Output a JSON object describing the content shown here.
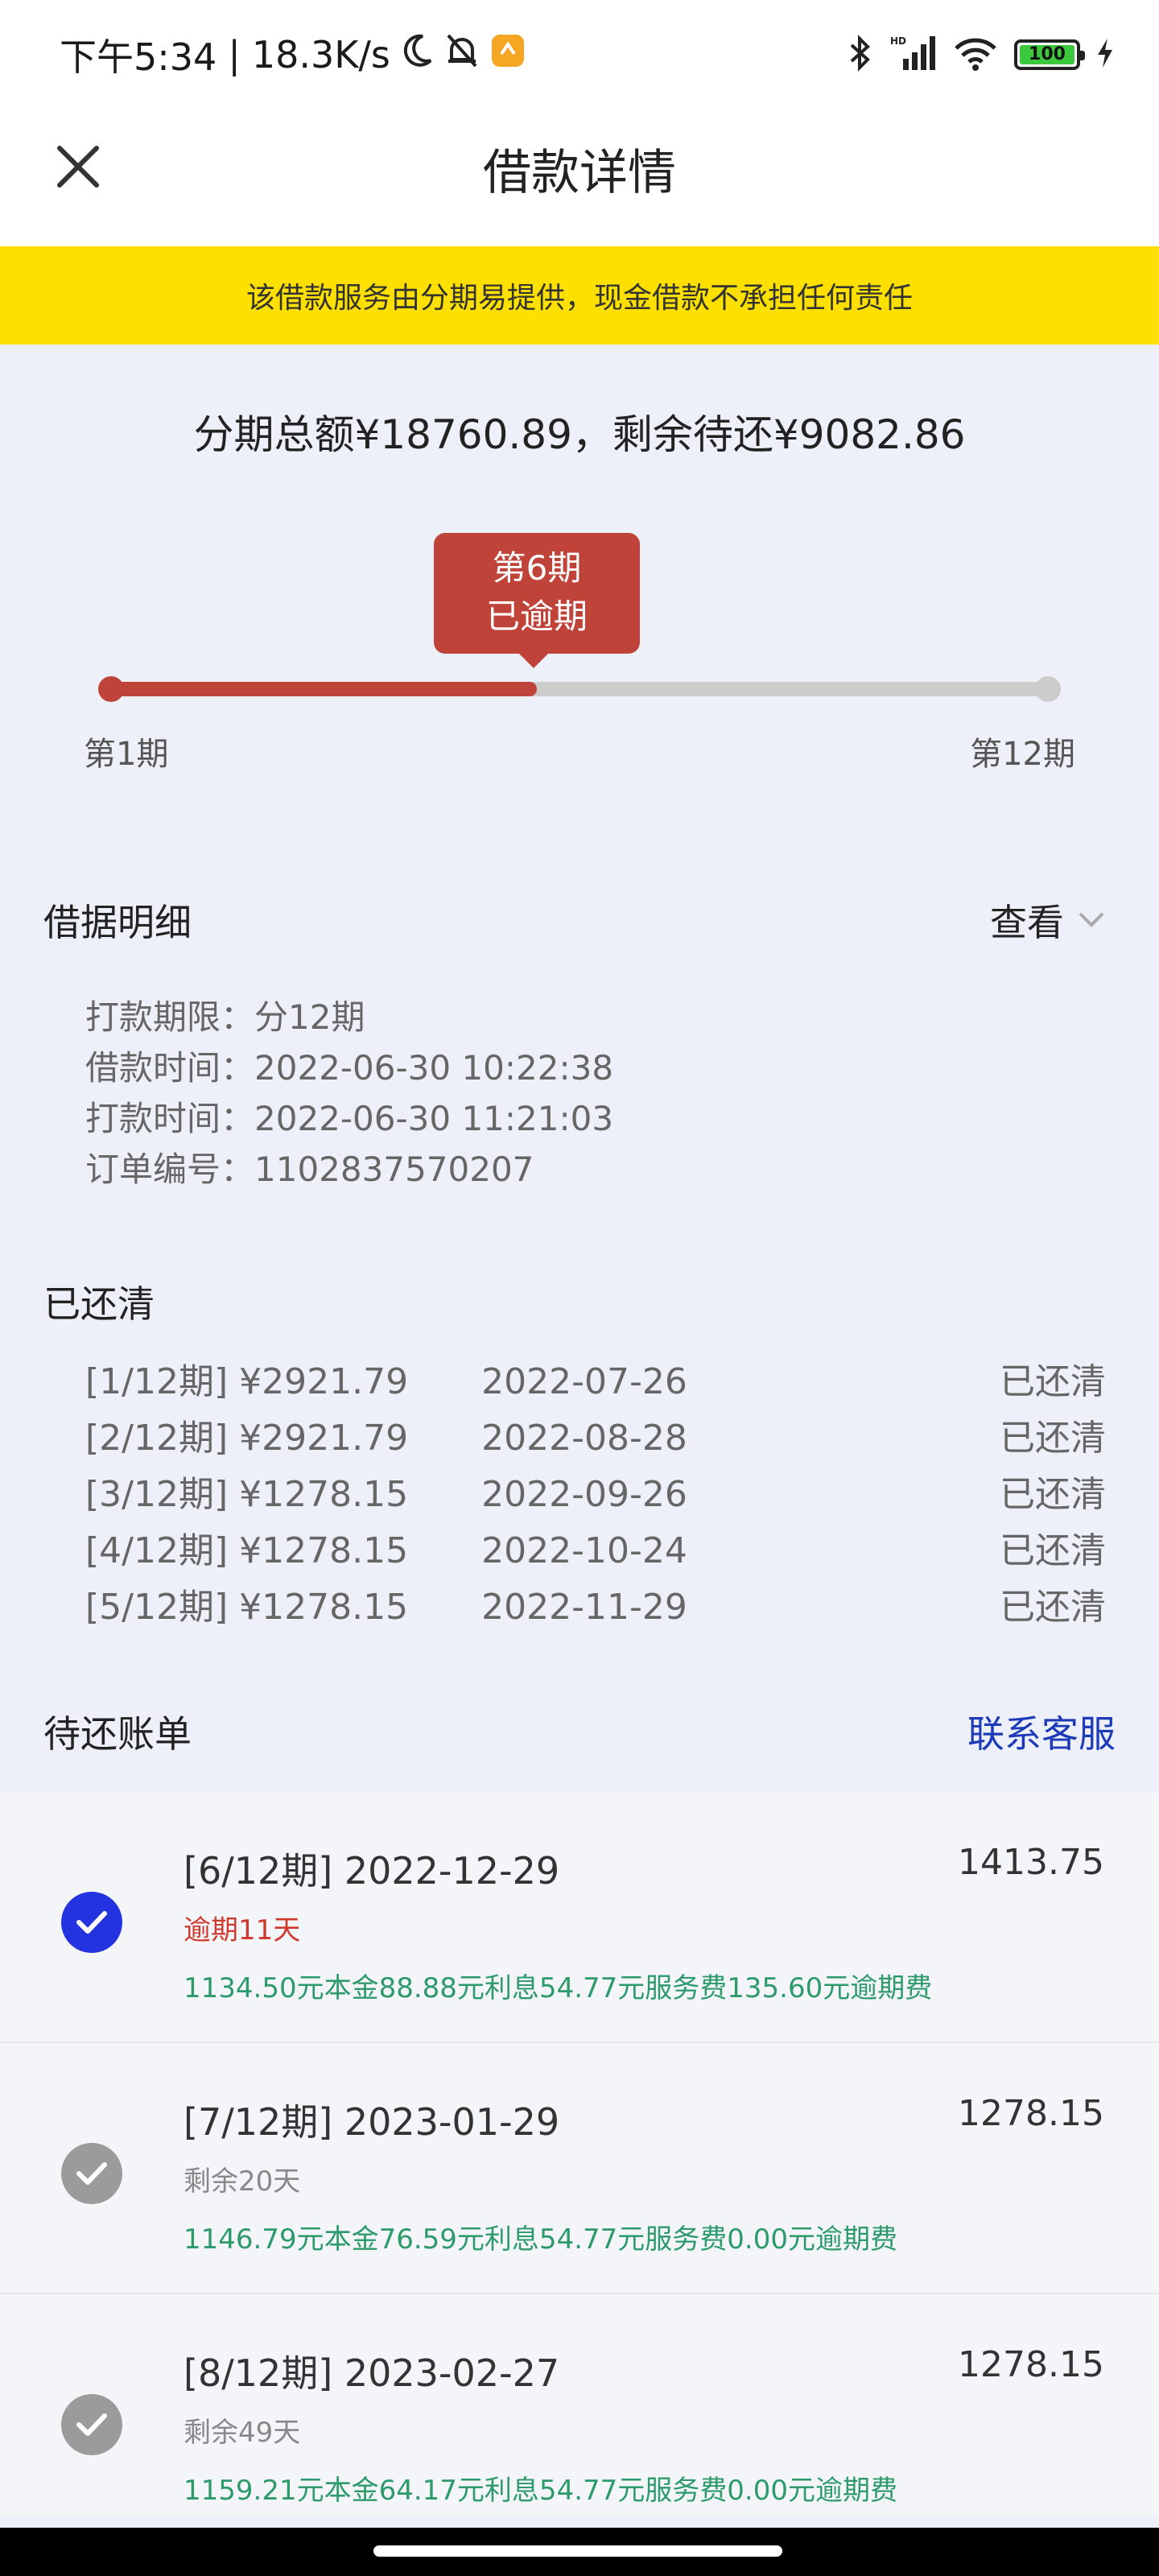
{
  "status_bar": {
    "time": "下午5:34",
    "separator": "|",
    "network_speed": "18.3K/s",
    "battery": "100",
    "icons_left": [
      "moon-icon",
      "bell-off-icon",
      "app-notification-icon"
    ],
    "icons_right": [
      "bluetooth-icon",
      "signal-icon",
      "wifi-icon",
      "battery-icon",
      "charging-icon"
    ],
    "signal_label": "HD"
  },
  "nav": {
    "title": "借款详情",
    "close_icon": "close-icon"
  },
  "notice": {
    "text": "该借款服务由分期易提供，现金借款不承担任何责任",
    "bg": "#fde000"
  },
  "summary": {
    "text": "分期总额¥18760.89，剩余待还¥9082.86"
  },
  "progress": {
    "current_label": "第6期",
    "current_status": "已逾期",
    "start_label": "第1期",
    "end_label": "第12期",
    "current": 6,
    "total": 12,
    "accent": "#c0433a"
  },
  "loan_detail": {
    "title": "借据明细",
    "view_label": "查看",
    "rows": [
      {
        "label": "打款期限：",
        "value": "分12期"
      },
      {
        "label": "借款时间：",
        "value": "2022-06-30 10:22:38"
      },
      {
        "label": "打款时间：",
        "value": "2022-06-30 11:21:03"
      },
      {
        "label": "订单编号：",
        "value": "1102837570207"
      }
    ]
  },
  "paid": {
    "title": "已还清",
    "rows": [
      {
        "period": "[1/12期] ¥2921.79",
        "date": "2022-07-26",
        "status": "已还清"
      },
      {
        "period": "[2/12期] ¥2921.79",
        "date": "2022-08-28",
        "status": "已还清"
      },
      {
        "period": "[3/12期] ¥1278.15",
        "date": "2022-09-26",
        "status": "已还清"
      },
      {
        "period": "[4/12期] ¥1278.15",
        "date": "2022-10-24",
        "status": "已还清"
      },
      {
        "period": "[5/12期] ¥1278.15",
        "date": "2022-11-29",
        "status": "已还清"
      }
    ]
  },
  "pending": {
    "title": "待还账单",
    "contact_label": "联系客服",
    "bills": [
      {
        "title": "[6/12期] 2022-12-29",
        "amount": "1413.75",
        "sub": "逾期11天",
        "breakdown": "1134.50元本金88.88元利息54.77元服务费135.60元逾期费",
        "checked": true
      },
      {
        "title": "[7/12期] 2023-01-29",
        "amount": "1278.15",
        "sub": "剩余20天",
        "breakdown": "1146.79元本金76.59元利息54.77元服务费0.00元逾期费",
        "checked": false
      },
      {
        "title": "[8/12期] 2023-02-27",
        "amount": "1278.15",
        "sub": "剩余49天",
        "breakdown": "1159.21元本金64.17元利息54.77元服务费0.00元逾期费",
        "checked": false
      }
    ]
  },
  "colors": {
    "accent_red": "#c0433a",
    "link_blue": "#1d3bb8",
    "check_blue": "#2333e0",
    "green_text": "#2d9a6c"
  }
}
